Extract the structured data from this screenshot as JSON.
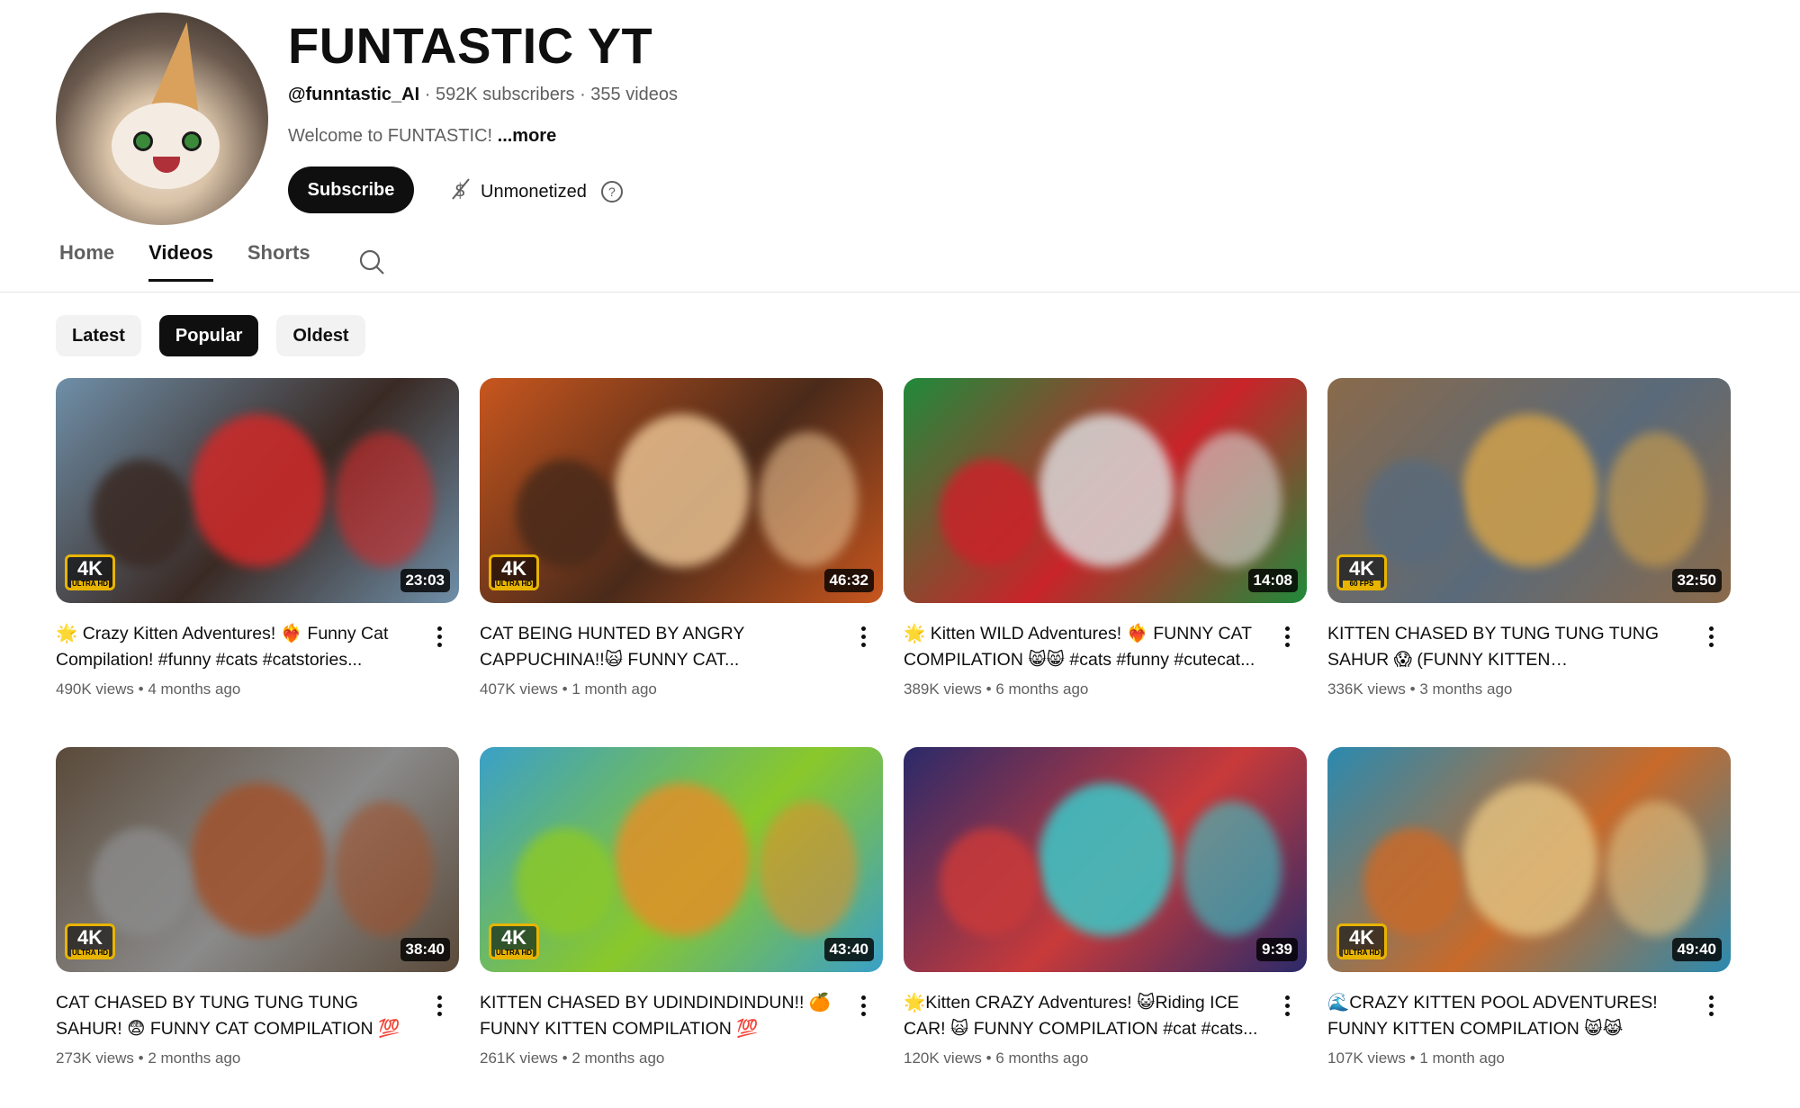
{
  "channel": {
    "title": "FUNTASTIC YT",
    "handle": "@funntastic_AI",
    "subscribers": "592K subscribers",
    "video_count": "355 videos",
    "description": "Welcome to FUNTASTIC!",
    "more_label": "...more",
    "subscribe_label": "Subscribe",
    "unmonetized_label": "Unmonetized"
  },
  "tabs": [
    "Home",
    "Videos",
    "Shorts"
  ],
  "active_tab": "Videos",
  "chips": [
    "Latest",
    "Popular",
    "Oldest"
  ],
  "active_chip": "Popular",
  "videos": [
    {
      "title": "🌟 Crazy Kitten Adventures! ❤️‍🔥 Funny Cat Compilation! #funny #cats #catstories...",
      "views": "490K views",
      "age": "4 months ago",
      "duration": "23:03",
      "badge": "4K",
      "badge_sub": "ULTRA HD",
      "colors": [
        "#6f8fa8",
        "#3a2a24",
        "#d02a2a"
      ]
    },
    {
      "title": "CAT BEING HUNTED BY ANGRY CAPPUCHINA!!🙀 FUNNY CAT...",
      "views": "407K views",
      "age": "1 month ago",
      "duration": "46:32",
      "badge": "4K",
      "badge_sub": "ULTRA HD",
      "colors": [
        "#c8561e",
        "#4a2a1a",
        "#e8c090"
      ]
    },
    {
      "title": "🌟 Kitten WILD Adventures! ❤️‍🔥 FUNNY CAT COMPILATION 😸😸 #cats #funny #cutecat...",
      "views": "389K views",
      "age": "6 months ago",
      "duration": "14:08",
      "badge": "",
      "badge_sub": "",
      "colors": [
        "#1f8a3a",
        "#c8242a",
        "#d8d8d8"
      ]
    },
    {
      "title": "KITTEN CHASED BY TUNG TUNG TUNG SAHUR 😱 (FUNNY KITTEN COMPILATION)...",
      "views": "336K views",
      "age": "3 months ago",
      "duration": "32:50",
      "badge": "4K",
      "badge_sub": "60 FPS",
      "colors": [
        "#8a6a4a",
        "#5a6a7a",
        "#d0a04a"
      ]
    },
    {
      "title": "CAT CHASED BY TUNG TUNG TUNG SAHUR! 😨 FUNNY CAT COMPILATION 💯",
      "views": "273K views",
      "age": "2 months ago",
      "duration": "38:40",
      "badge": "4K",
      "badge_sub": "ULTRA HD",
      "colors": [
        "#5a4a3a",
        "#8a8a8a",
        "#a0522d"
      ]
    },
    {
      "title": "KITTEN CHASED BY UDINDINDINDUN!! 🍊 FUNNY KITTEN COMPILATION 💯",
      "views": "261K views",
      "age": "2 months ago",
      "duration": "43:40",
      "badge": "4K",
      "badge_sub": "ULTRA HD",
      "colors": [
        "#3aa0c8",
        "#8ac82a",
        "#e0902a"
      ]
    },
    {
      "title": "🌟Kitten CRAZY Adventures! 😺Riding ICE CAR! 🙀 FUNNY COMPILATION #cat #cats...",
      "views": "120K views",
      "age": "6 months ago",
      "duration": "9:39",
      "badge": "",
      "badge_sub": "",
      "colors": [
        "#2a2a6a",
        "#c83a3a",
        "#3ac8c8"
      ]
    },
    {
      "title": "🌊CRAZY KITTEN POOL ADVENTURES! FUNNY KITTEN COMPILATION 😸😹",
      "views": "107K views",
      "age": "1 month ago",
      "duration": "49:40",
      "badge": "4K",
      "badge_sub": "ULTRA HD",
      "colors": [
        "#2a8ab0",
        "#c86a2a",
        "#e0c080"
      ]
    }
  ]
}
